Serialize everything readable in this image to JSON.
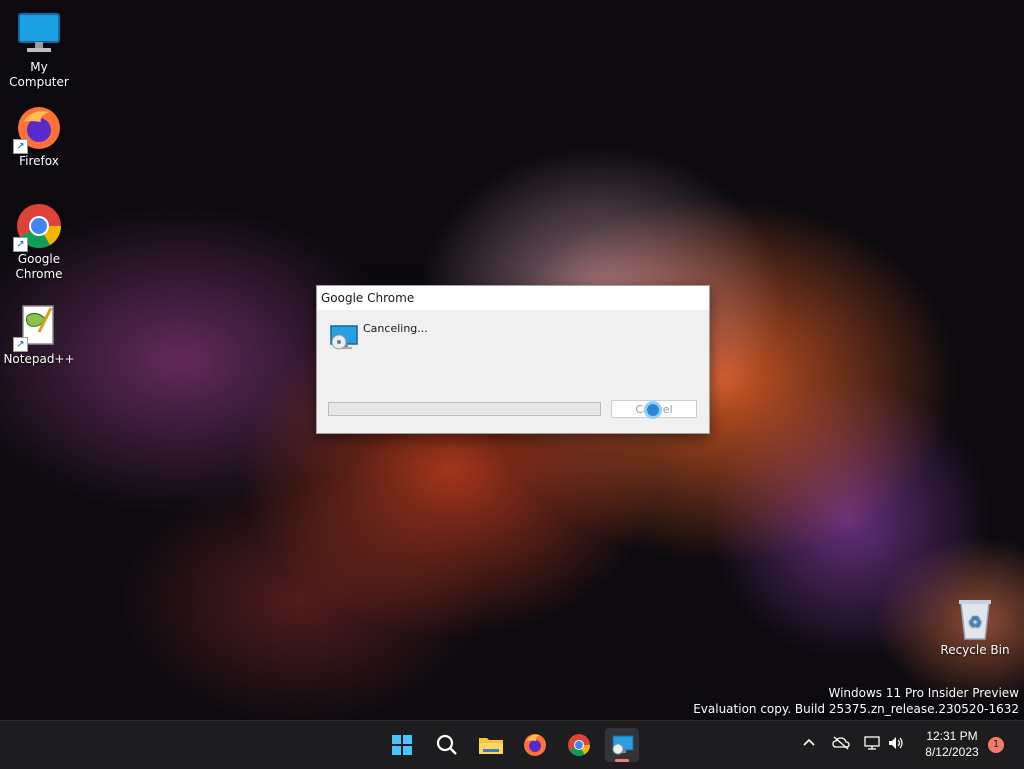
{
  "desktop": {
    "icons": [
      {
        "label": "My Computer",
        "icon": "monitor-icon"
      },
      {
        "label": "Firefox",
        "icon": "firefox-icon"
      },
      {
        "label": "Google Chrome",
        "icon": "chrome-icon"
      },
      {
        "label": "Notepad++",
        "icon": "notepadpp-icon"
      },
      {
        "label": "Recycle Bin",
        "icon": "recycle-bin-icon"
      }
    ],
    "watermark": {
      "line1": "Windows 11 Pro Insider Preview",
      "line2": "Evaluation copy. Build 25375.zn_release.230520-1632"
    }
  },
  "dialog": {
    "title": "Google Chrome",
    "message": "Canceling...",
    "progress": 0,
    "cancel_label": "Cancel"
  },
  "taskbar": {
    "apps": [
      "start-icon",
      "search-icon",
      "file-explorer-icon",
      "firefox-icon",
      "chrome-icon",
      "installer-icon"
    ],
    "active_app": "installer-icon",
    "clock_time": "12:31 PM",
    "clock_date": "8/12/2023",
    "notification_count": "1"
  },
  "colors": {
    "taskbar_bg": "#1d1d1f",
    "dialog_bg": "#f0f0f0",
    "accent": "#0078d4"
  }
}
